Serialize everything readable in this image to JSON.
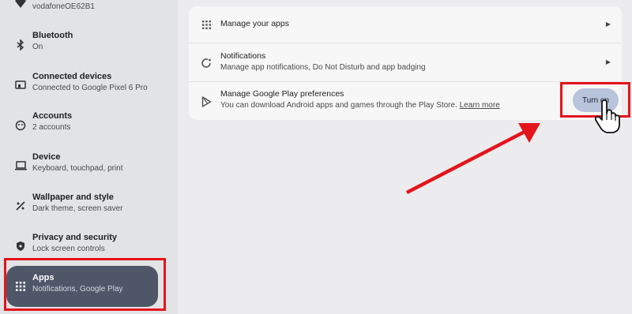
{
  "sidebar": {
    "wifi": {
      "subtitle": "vodafoneOE62B1",
      "icon": "wifi-icon"
    },
    "items": [
      {
        "title": "Bluetooth",
        "subtitle": "On",
        "icon": "bluetooth-icon"
      },
      {
        "title": "Connected devices",
        "subtitle": "Connected to Google Pixel 6 Pro",
        "icon": "connected-devices-icon"
      },
      {
        "title": "Accounts",
        "subtitle": "2 accounts",
        "icon": "accounts-icon"
      },
      {
        "title": "Device",
        "subtitle": "Keyboard, touchpad, print",
        "icon": "laptop-icon"
      },
      {
        "title": "Wallpaper and style",
        "subtitle": "Dark theme, screen saver",
        "icon": "palette-icon"
      },
      {
        "title": "Privacy and security",
        "subtitle": "Lock screen controls",
        "icon": "shield-icon"
      },
      {
        "title": "Apps",
        "subtitle": "Notifications, Google Play",
        "icon": "apps-grid-icon",
        "active": true
      }
    ]
  },
  "apps_panel": {
    "rows": [
      {
        "title": "Manage your apps",
        "icon": "apps-grid-icon"
      },
      {
        "title": "Notifications",
        "subtitle": "Manage app notifications, Do Not Disturb and app badging",
        "icon": "notifications-icon"
      },
      {
        "title": "Manage Google Play preferences",
        "subtitle": "You can download Android apps and games through the Play Store.",
        "link": "Learn more",
        "icon": "play-store-icon"
      }
    ],
    "turn_on_label": "Turn on"
  },
  "colors": {
    "highlight": "#e4141c",
    "active_nav": "#4e5668",
    "button": "#b8c3dc"
  }
}
